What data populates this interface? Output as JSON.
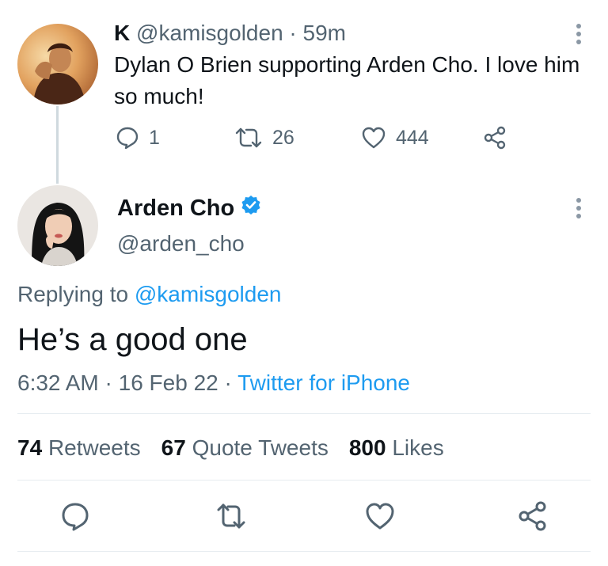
{
  "parent_tweet": {
    "display_name": "K",
    "handle": "@kamisgolden",
    "separator": "·",
    "time": "59m",
    "text": "Dylan O Brien supporting Arden Cho. I love him so much!",
    "reply_count": "1",
    "retweet_count": "26",
    "like_count": "444"
  },
  "main_tweet": {
    "display_name": "Arden Cho",
    "handle": "@arden_cho",
    "replying_prefix": "Replying to",
    "replying_handle": "@kamisgolden",
    "text": "He’s a good one",
    "time": "6:32 AM",
    "dot1": "·",
    "date": "16 Feb 22",
    "dot2": "·",
    "source": "Twitter for iPhone"
  },
  "stats": {
    "retweets_count": "74",
    "retweets_label": "Retweets",
    "quotes_count": "67",
    "quotes_label": "Quote Tweets",
    "likes_count": "800",
    "likes_label": "Likes"
  },
  "colors": {
    "text": "#0f1419",
    "muted": "#536471",
    "link": "#1d9bf0",
    "verified": "#1d9bf0",
    "divider": "#e6ecf0"
  },
  "icons": [
    "reply-icon",
    "retweet-icon",
    "like-icon",
    "share-icon",
    "more-icon",
    "verified-badge-icon"
  ]
}
